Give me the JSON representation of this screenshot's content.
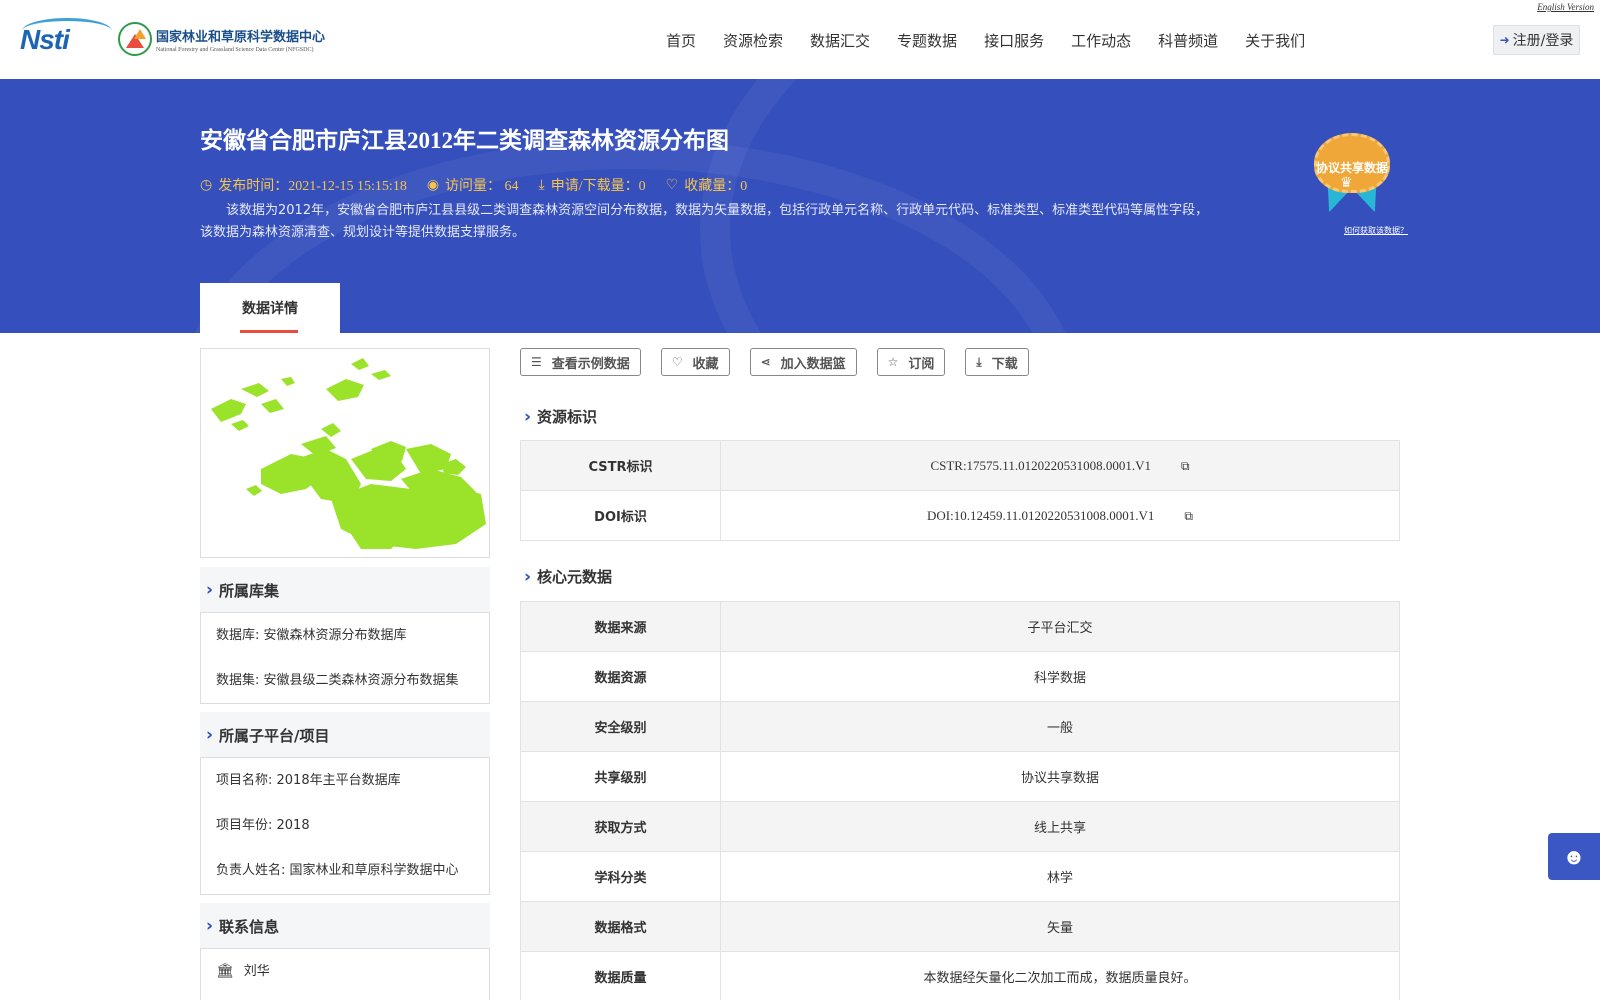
{
  "header": {
    "english_link": "English Version",
    "logo_nsti": "Nsti",
    "logo_cn": "国家林业和草原科学数据中心",
    "logo_en": "National Forestry and Grassland Science Data Center (NFGSDC)",
    "nav": [
      "首页",
      "资源检索",
      "数据汇交",
      "专题数据",
      "接口服务",
      "工作动态",
      "科普频道",
      "关于我们"
    ],
    "login_label": "注册/登录"
  },
  "banner": {
    "title": "安徽省合肥市庐江县2012年二类调查森林资源分布图",
    "publish_label": "发布时间：2021-12-15 15:15:18",
    "visits_label": "访问量：  64",
    "downloads_label": "申请/下载量：0",
    "favorites_label": "收藏量：0",
    "description": "该数据为2012年，安徽省合肥市庐江县县级二类调查森林资源空间分布数据，数据为矢量数据，包括行政单元名称、行政单元代码、标准类型、标准类型代码等属性字段，该数据为森林资源清查、规划设计等提供数据支撑服务。",
    "badge_label": "协议共享数据",
    "how_link": "如何获取该数据？",
    "tab_label": "数据详情"
  },
  "left": {
    "library_title": "所属库集",
    "library_lines": [
      "数据库: 安徽森林资源分布数据库",
      "数据集: 安徽县级二类森林资源分布数据集"
    ],
    "project_title": "所属子平台/项目",
    "project_lines": [
      "项目名称: 2018年主平台数据库",
      "项目年份: 2018",
      "负责人姓名: 国家林业和草原科学数据中心"
    ],
    "contact_title": "联系信息",
    "contact_name": "刘华"
  },
  "actions": [
    "查看示例数据",
    "收藏",
    "加入数据篮",
    "订阅",
    "下载"
  ],
  "resource_id": {
    "title": "资源标识",
    "rows": [
      {
        "key": "CSTR标识",
        "value": "CSTR:17575.11.0120220531008.0001.V1"
      },
      {
        "key": "DOI标识",
        "value": "DOI:10.12459.11.0120220531008.0001.V1"
      }
    ]
  },
  "core_meta": {
    "title": "核心元数据",
    "rows": [
      {
        "key": "数据来源",
        "value": "子平台汇交"
      },
      {
        "key": "数据资源",
        "value": "科学数据"
      },
      {
        "key": "安全级别",
        "value": "一般"
      },
      {
        "key": "共享级别",
        "value": "协议共享数据"
      },
      {
        "key": "获取方式",
        "value": "线上共享"
      },
      {
        "key": "学科分类",
        "value": "林学"
      },
      {
        "key": "数据格式",
        "value": "矢量"
      },
      {
        "key": "数据质量",
        "value": "本数据经矢量化二次加工而成，数据质量良好。"
      }
    ]
  },
  "colors": {
    "banner": "#3550bd",
    "meta_text": "#f5c44d",
    "accent_chevron": "#2b4bbf",
    "map_green": "#9be22a"
  }
}
